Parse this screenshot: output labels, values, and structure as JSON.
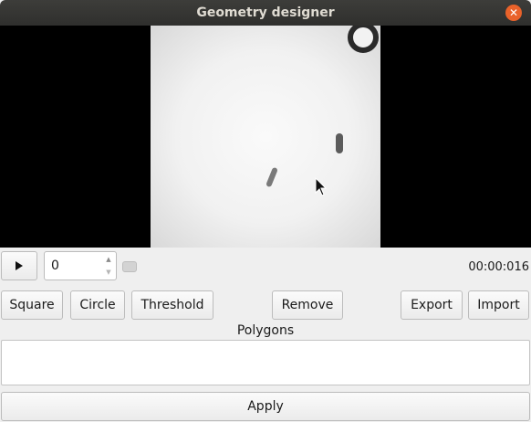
{
  "window": {
    "title": "Geometry designer",
    "close_glyph": "✕"
  },
  "player": {
    "play_icon": "play-icon",
    "frame_value": "0",
    "time": "00:00:016"
  },
  "toolbar": {
    "square_label": "Square",
    "circle_label": "Circle",
    "threshold_label": "Threshold",
    "remove_label": "Remove",
    "export_label": "Export",
    "import_label": "Import"
  },
  "polygons": {
    "label": "Polygons",
    "items": []
  },
  "apply_label": "Apply",
  "colors": {
    "titlebar": "#2f2f2d",
    "close_button": "#e9622a",
    "window_bg": "#efefef"
  }
}
